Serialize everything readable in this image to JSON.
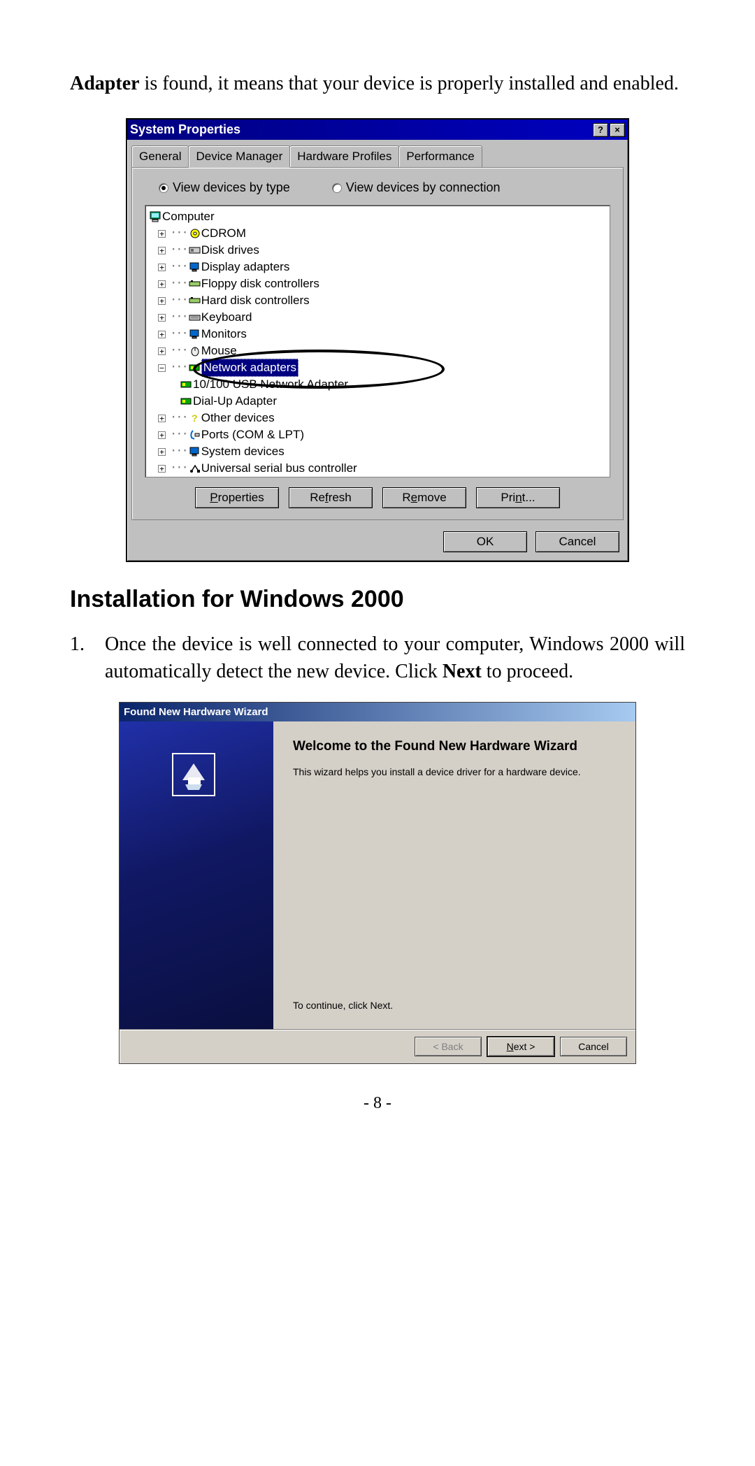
{
  "intro": {
    "bold_word": "Adapter",
    "rest": " is found, it means that your device is properly installed and enabled."
  },
  "sysprops": {
    "title": "System Properties",
    "help_glyph": "?",
    "close_glyph": "×",
    "tabs": [
      "General",
      "Device Manager",
      "Hardware Profiles",
      "Performance"
    ],
    "active_tab_index": 1,
    "radio_type": "View devices by type",
    "radio_conn": "View devices by connection",
    "radio_selected": "type",
    "tree": {
      "root": "Computer",
      "items": [
        {
          "label": "CDROM",
          "icon": "cdrom"
        },
        {
          "label": "Disk drives",
          "icon": "disk"
        },
        {
          "label": "Display adapters",
          "icon": "display"
        },
        {
          "label": "Floppy disk controllers",
          "icon": "controller"
        },
        {
          "label": "Hard disk controllers",
          "icon": "controller"
        },
        {
          "label": "Keyboard",
          "icon": "keyboard"
        },
        {
          "label": "Monitors",
          "icon": "display"
        },
        {
          "label": "Mouse",
          "icon": "mouse"
        }
      ],
      "network": {
        "label": "Network adapters",
        "children": [
          {
            "label": "10/100 USB Network Adapter",
            "icon": "nic"
          },
          {
            "label": "Dial-Up Adapter",
            "icon": "nic"
          }
        ]
      },
      "after": [
        {
          "label": "Other devices",
          "icon": "question"
        },
        {
          "label": "Ports (COM & LPT)",
          "icon": "ports"
        },
        {
          "label": "System devices",
          "icon": "display"
        },
        {
          "label": "Universal serial bus controller",
          "icon": "usb"
        }
      ]
    },
    "buttons": {
      "properties": "Properties",
      "refresh": "Refresh",
      "remove": "Remove",
      "print": "Print..."
    },
    "ok": "OK",
    "cancel": "Cancel"
  },
  "section_heading": "Installation for Windows 2000",
  "step1": {
    "num": "1.",
    "pre": "Once the device is well connected to your computer, Windows 2000 will automatically detect the new device.   Click ",
    "bold": "Next",
    "post": " to proceed."
  },
  "wizard": {
    "title": "Found New Hardware Wizard",
    "heading": "Welcome to the Found New Hardware Wizard",
    "text": "This wizard helps you install a device driver for a hardware device.",
    "continue": "To continue, click Next.",
    "back": "< Back",
    "next": "Next >",
    "cancel": "Cancel"
  },
  "page_number": "- 8 -"
}
